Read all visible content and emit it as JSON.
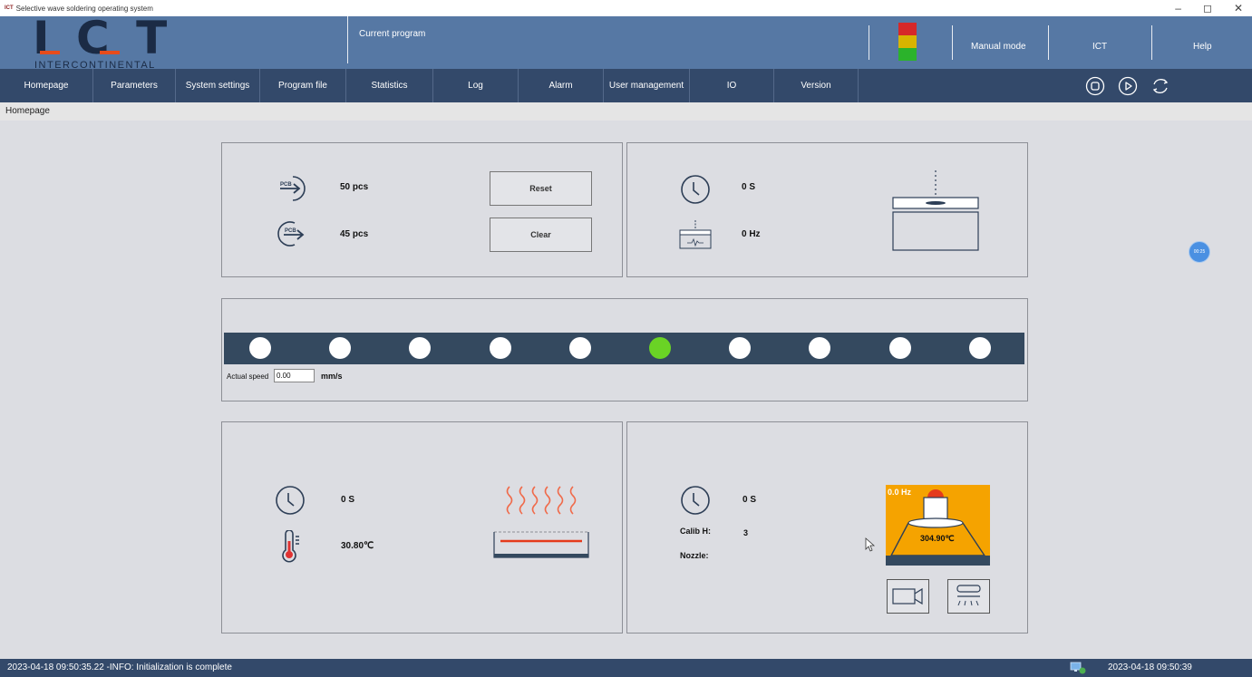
{
  "window": {
    "app_icon_text": "ICT",
    "title": "Selective wave soldering operating system",
    "controls": [
      "–",
      "◻",
      "✕"
    ]
  },
  "header": {
    "logo_text": "I C T",
    "logo_subtext": "INTERCONTINENTAL",
    "current_program_label": "Current program",
    "mode": "Manual mode",
    "user": "ICT",
    "help": "Help",
    "tower_colors": [
      "#d62828",
      "#f4c20d",
      "#2bb32b"
    ]
  },
  "nav": {
    "items": [
      "Homepage",
      "Parameters",
      "System settings",
      "Program file",
      "Statistics",
      "Log",
      "Alarm",
      "User management",
      "IO",
      "Version"
    ]
  },
  "breadcrumb": "Homepage",
  "counters": {
    "in_count": "50 pcs",
    "out_count": "45 pcs",
    "reset_label": "Reset",
    "clear_label": "Clear",
    "pcb_icon_text": "PCB"
  },
  "fluxer": {
    "time": "0 S",
    "frequency": "0 Hz"
  },
  "conveyor": {
    "stations": [
      false,
      false,
      false,
      false,
      false,
      true,
      false,
      false,
      false,
      false
    ],
    "speed_label": "Actual speed",
    "speed_value": "0.00",
    "speed_unit": "mm/s"
  },
  "preheat": {
    "time": "0 S",
    "temperature": "30.80℃"
  },
  "solder": {
    "time": "0 S",
    "calib_label": "Calib H:",
    "calib_value": "3",
    "nozzle_label": "Nozzle:",
    "nozzle_value": "",
    "pot_frequency": "0.0 Hz",
    "pot_temperature": "304.90℃",
    "pot_color": "#f5a300"
  },
  "timer_bubble": "00:25",
  "status": {
    "message": "2023-04-18 09:50:35.22 -INFO: Initialization is complete",
    "clock": "2023-04-18 09:50:39"
  }
}
